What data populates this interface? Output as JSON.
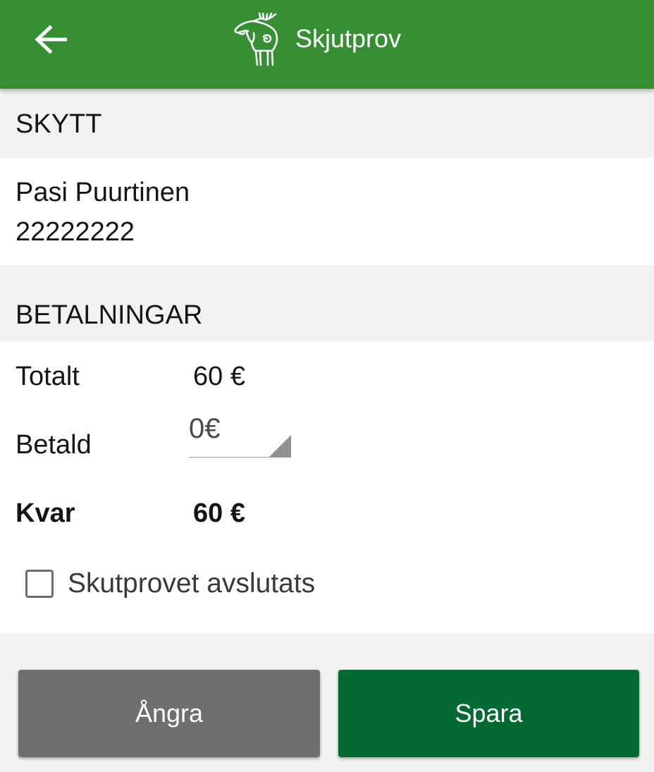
{
  "appbar": {
    "title": "Skjutprov",
    "back_icon": "arrow-left-icon",
    "logo_icon": "moose-logo-icon",
    "color": "#368f33"
  },
  "shooter": {
    "header": "SKYTT",
    "name": "Pasi Puurtinen",
    "id_number": "22222222"
  },
  "payments": {
    "header": "BETALNINGAR",
    "total_label": "Totalt",
    "total_value": "60 €",
    "paid_label": "Betald",
    "paid_value": "0€",
    "remaining_label": "Kvar",
    "remaining_value": "60 €"
  },
  "completed": {
    "label": "Skutprovet avslutats",
    "checked": false
  },
  "buttons": {
    "cancel_label": "Ångra",
    "save_label": "Spara",
    "cancel_color": "#6f6f6f",
    "save_color": "#046a34"
  }
}
